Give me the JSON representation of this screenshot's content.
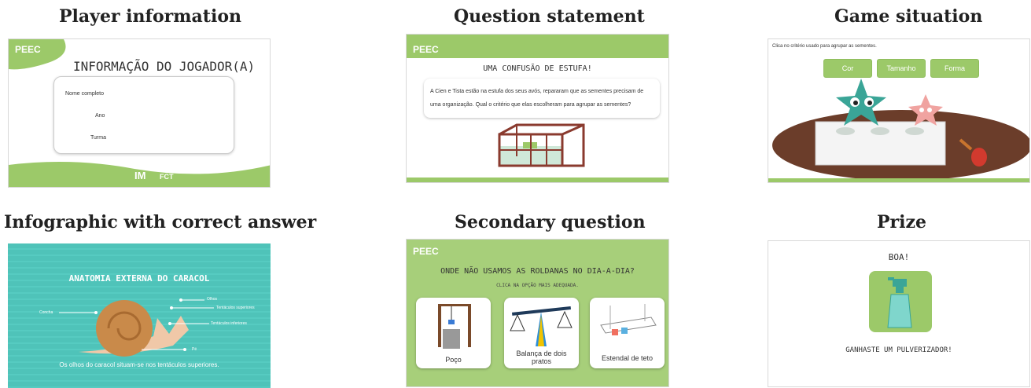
{
  "captions": {
    "player": "Player information",
    "question": "Question statement",
    "game": "Game situation",
    "infographic": "Infographic with correct answer",
    "secondary": "Secondary question",
    "prize": "Prize"
  },
  "brand": "PEEC",
  "player_panel": {
    "title": "INFORMAÇÃO DO JOGADOR(A)",
    "fields": [
      "Nome completo",
      "Ano",
      "Turma"
    ],
    "footer_logos": [
      "IM",
      "FCT"
    ]
  },
  "question_panel": {
    "title": "UMA CONFUSÃO DE ESTUFA!",
    "text": "A Cien e Tista estão na estufa dos seus avós, repararam que as sementes precisam de uma organização. Qual o critério que elas escolheram para agrupar as sementes?"
  },
  "game_panel": {
    "instruction": "Clica no critério usado para agrupar as sementes.",
    "options": [
      "Cor",
      "Tamanho",
      "Forma"
    ]
  },
  "infographic_panel": {
    "title": "ANATOMIA EXTERNA DO CARACOL",
    "labels": [
      "Olhos",
      "Tentáculos superiores",
      "Concha",
      "Tentáculos inferiores",
      "Pé"
    ],
    "caption": "Os olhos do caracol situam-se nos tentáculos superiores."
  },
  "secondary_panel": {
    "title": "ONDE NÃO USAMOS AS ROLDANAS NO DIA-A-DIA?",
    "subtitle": "CLICA NA OPÇÃO MAIS ADEQUADA.",
    "options": [
      "Poço",
      "Balança de dois pratos",
      "Estendal de teto"
    ]
  },
  "prize_panel": {
    "title": "BOA!",
    "text": "GANHASTE UM PULVERIZADOR!"
  },
  "colors": {
    "green": "#9cc969",
    "teal": "#4fc3b9",
    "brown": "#6b3d2a"
  }
}
